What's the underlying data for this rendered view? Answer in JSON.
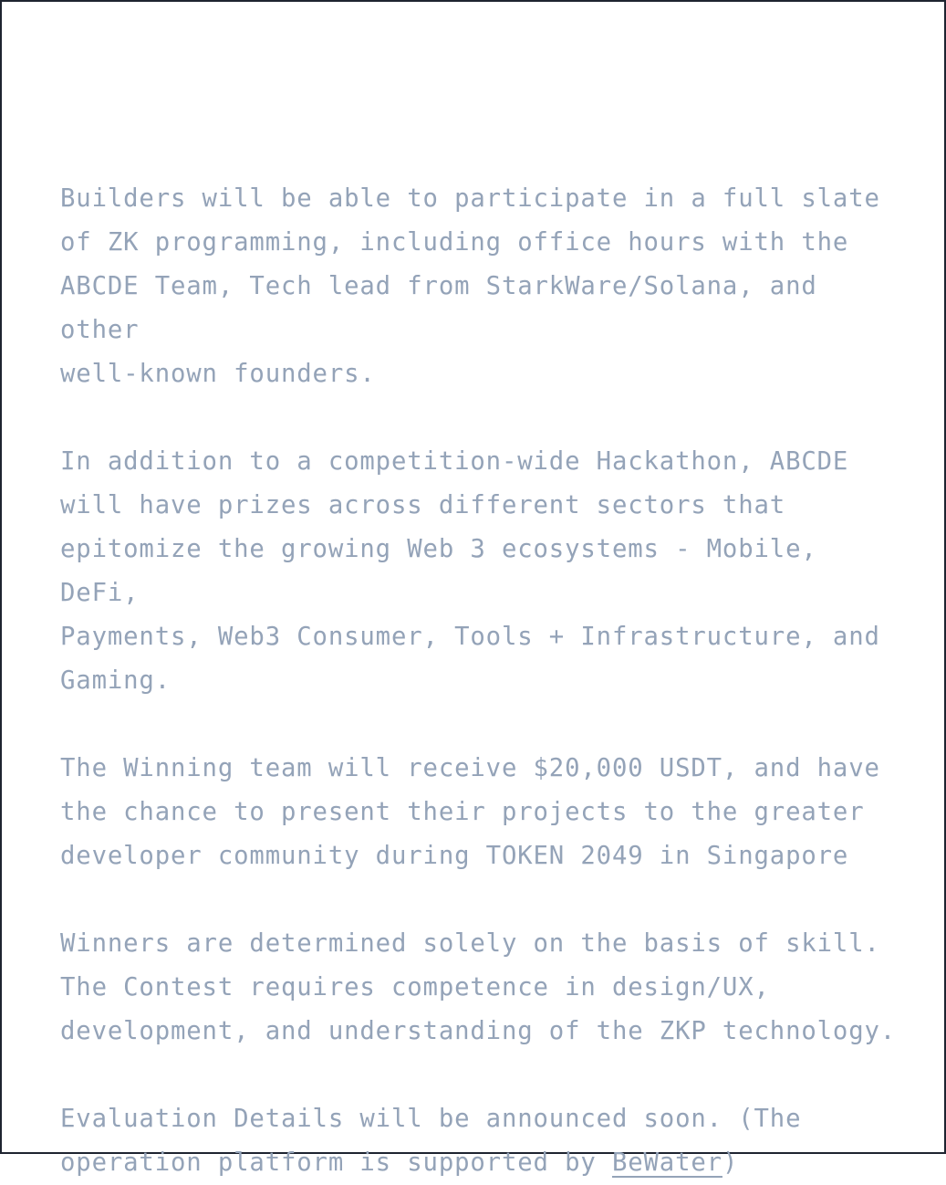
{
  "paragraphs": [
    "Builders will be able to participate in a full slate\nof ZK programming, including office hours with the\nABCDE Team, Tech lead from StarkWare/Solana, and other\nwell-known founders.",
    "In addition to a competition-wide Hackathon, ABCDE\nwill have prizes across different sectors that\nepitomize the growing Web 3 ecosystems - Mobile, DeFi,\nPayments, Web3 Consumer, Tools + Infrastructure, and\nGaming.",
    "The Winning team will receive $20,000 USDT, and have\nthe chance to present their projects to the greater\ndeveloper community during TOKEN 2049 in Singapore",
    "Winners are determined solely on the basis of skill.\nThe Contest requires competence in design/UX,\ndevelopment, and understanding of the ZKP technology."
  ],
  "last_paragraph": {
    "text_before_link": "Evaluation Details will be announced soon. (The\noperation platform is supported by ",
    "link_label": "BeWater",
    "text_after_link": ")"
  },
  "colors": {
    "text": "#94a3b8",
    "border": "#1e2430",
    "background": "#ffffff"
  }
}
